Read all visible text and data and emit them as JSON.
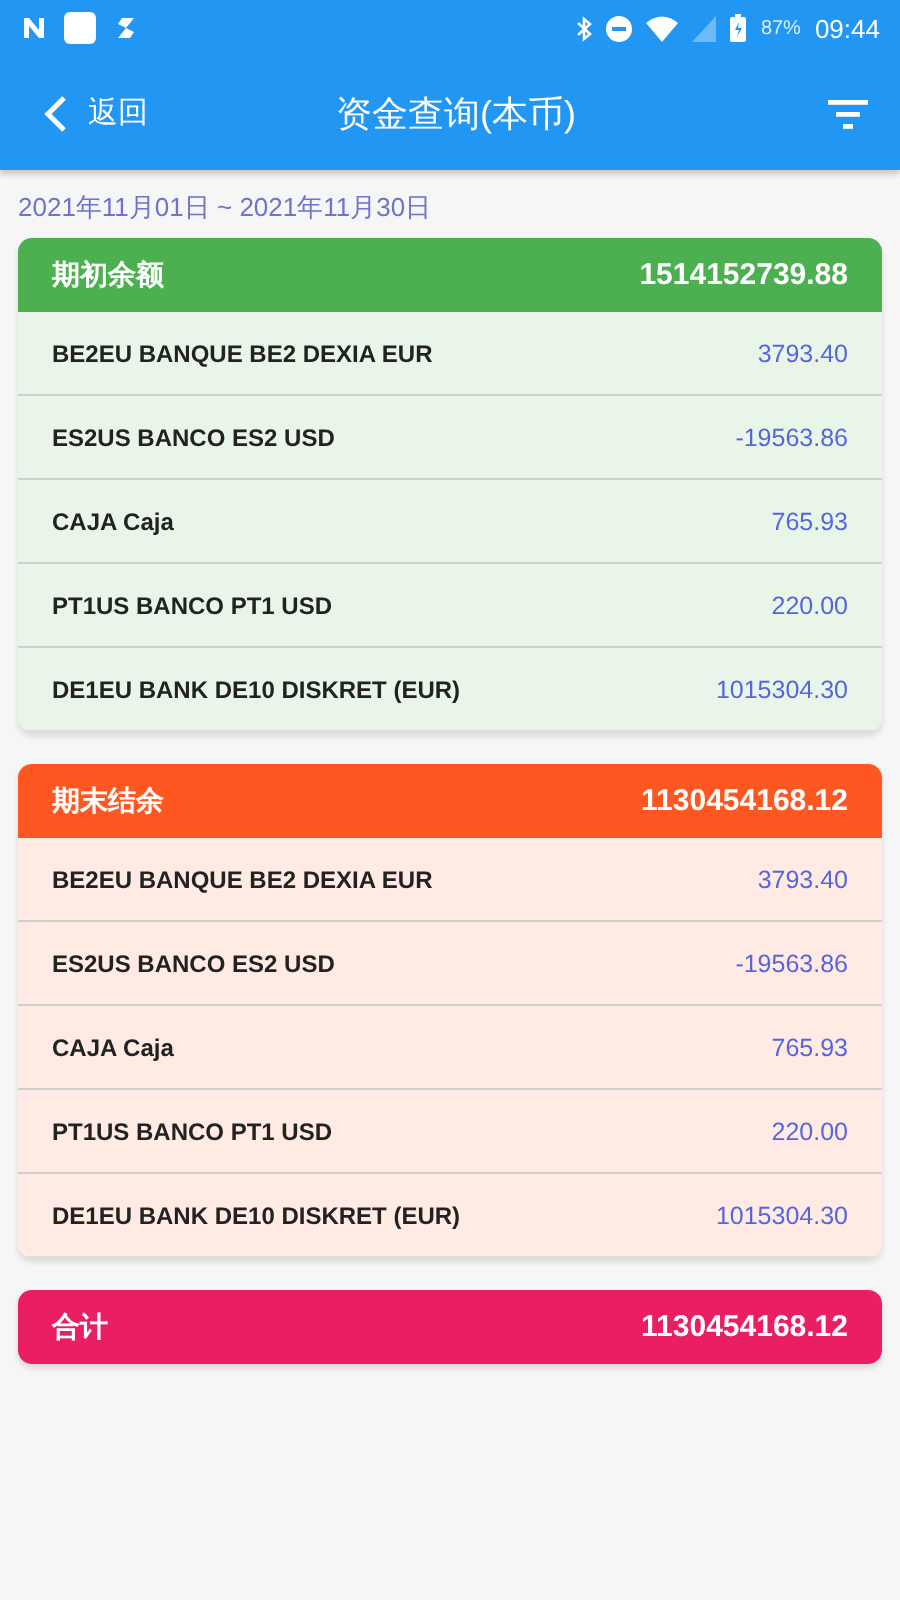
{
  "status_bar": {
    "battery": "87%",
    "time": "09:44"
  },
  "app_bar": {
    "back_label": "返回",
    "title": "资金查询(本币)"
  },
  "date_range": "2021年11月01日 ~ 2021年11月30日",
  "sections": [
    {
      "title": "期初余额",
      "total": "1514152739.88",
      "color": "#4caf50",
      "rows": [
        {
          "account": "BE2EU BANQUE BE2 DEXIA EUR",
          "amount": "3793.40"
        },
        {
          "account": "ES2US BANCO ES2 USD",
          "amount": "-19563.86"
        },
        {
          "account": "CAJA Caja",
          "amount": "765.93"
        },
        {
          "account": "PT1US BANCO PT1 USD",
          "amount": "220.00"
        },
        {
          "account": "DE1EU BANK DE10 DISKRET (EUR)",
          "amount": "1015304.30"
        }
      ]
    },
    {
      "title": "期末结余",
      "total": "1130454168.12",
      "color": "#ff5722",
      "rows": [
        {
          "account": "BE2EU BANQUE BE2 DEXIA EUR",
          "amount": "3793.40"
        },
        {
          "account": "ES2US BANCO ES2 USD",
          "amount": "-19563.86"
        },
        {
          "account": "CAJA Caja",
          "amount": "765.93"
        },
        {
          "account": "PT1US BANCO PT1 USD",
          "amount": "220.00"
        },
        {
          "account": "DE1EU BANK DE10 DISKRET (EUR)",
          "amount": "1015304.30"
        }
      ]
    },
    {
      "title": "合计",
      "total": "1130454168.12",
      "color": "#e91e63"
    }
  ]
}
